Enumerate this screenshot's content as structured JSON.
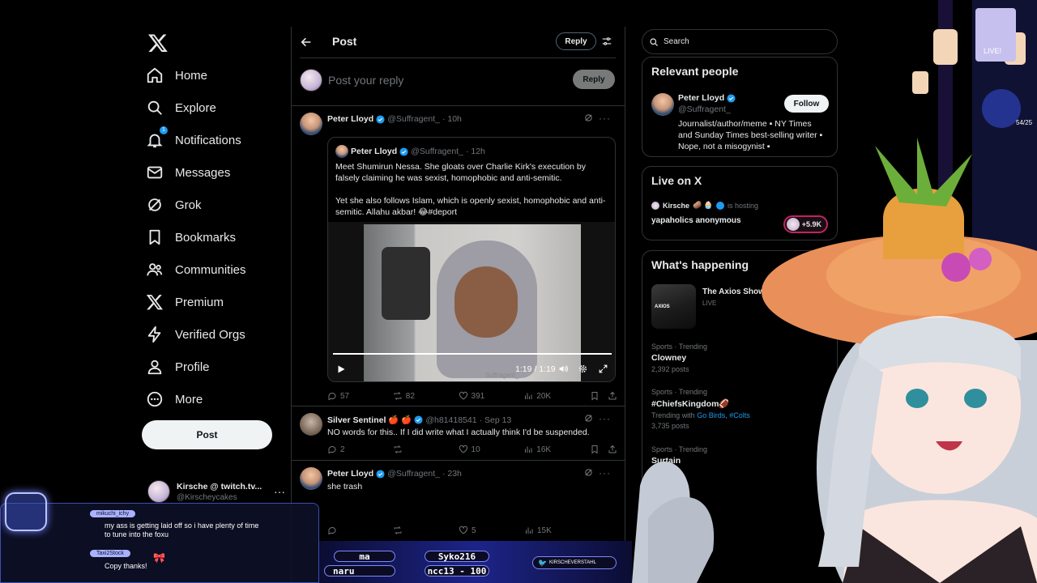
{
  "nav": {
    "items": [
      {
        "label": "Home",
        "icon": "home-icon"
      },
      {
        "label": "Explore",
        "icon": "search-icon"
      },
      {
        "label": "Notifications",
        "icon": "bell-icon",
        "badge": "1"
      },
      {
        "label": "Messages",
        "icon": "mail-icon"
      },
      {
        "label": "Grok",
        "icon": "grok-icon"
      },
      {
        "label": "Bookmarks",
        "icon": "bookmark-icon"
      },
      {
        "label": "Communities",
        "icon": "people-icon"
      },
      {
        "label": "Premium",
        "icon": "x-icon"
      },
      {
        "label": "Verified Orgs",
        "icon": "bolt-icon"
      },
      {
        "label": "Profile",
        "icon": "person-icon"
      },
      {
        "label": "More",
        "icon": "more-circle-icon"
      }
    ],
    "post_label": "Post",
    "account": {
      "name": "Kirsche @ twitch.tv...",
      "handle": "@Kirscheycakes"
    }
  },
  "header": {
    "title": "Post",
    "reply_label": "Reply"
  },
  "compose": {
    "placeholder": "Post your reply",
    "button": "Reply"
  },
  "main_tweet": {
    "name": "Peter Lloyd",
    "handle": "@Suffragent_",
    "time": "· 10h",
    "quote": {
      "name": "Peter Lloyd",
      "handle": "@Suffragent_",
      "time": "· 12h",
      "text1": "Meet Shumirun Nessa.  She gloats over Charlie Kirk's execution by falsely claiming he was sexist, homophobic and anti-semitic.",
      "text2": "Yet she also follows Islam, which is openly sexist, homophobic and anti-semitic. Allahu akbar! 😂#deport",
      "video_time": "1:19 / 1:19",
      "watermark": "Suffragent_"
    },
    "stats": {
      "replies": "57",
      "reposts": "82",
      "likes": "391",
      "views": "20K"
    }
  },
  "replies": [
    {
      "name": "Silver Sentinel 🍎 🍎",
      "handle": "@h81418541",
      "time": "· Sep 13",
      "text": "NO words for this..  If I did write what I actually think I'd be suspended.",
      "stats": {
        "replies": "2",
        "reposts": "",
        "likes": "10",
        "views": "16K"
      }
    },
    {
      "name": "Peter Lloyd",
      "handle": "@Suffragent_",
      "time": "· 23h",
      "text": "she trash",
      "stats": {
        "replies": "",
        "reposts": "",
        "likes": "5",
        "views": "15K"
      }
    }
  ],
  "right": {
    "search_placeholder": "Search",
    "relevant": {
      "title": "Relevant people",
      "name": "Peter Lloyd",
      "handle": "@Suffragent_",
      "follow": "Follow",
      "bio": "Journalist/author/meme ▪ NY Times and Sunday Times best-selling writer ▪ Nope, not a misogynist ▪"
    },
    "live": {
      "title": "Live on X",
      "host": "Kirsche",
      "emojis": "🥔 🧁",
      "hosting": "is hosting",
      "space": "yapaholics anonymous",
      "listeners": "+5.9K"
    },
    "happening": {
      "title": "What's happening",
      "show": "The Axios Show",
      "show_status": "LIVE",
      "thumb_tag": "AXIOS",
      "trends": [
        {
          "category": "Sports · Trending",
          "title": "Clowney",
          "count": "2,392 posts"
        },
        {
          "category": "Sports · Trending",
          "title": "#ChiefsKingdom🏈",
          "trending_with": "Trending with",
          "links": "Go Birds, #Colts",
          "count": "3,735 posts"
        },
        {
          "category": "Sports · Trending",
          "title": "Surtain",
          "count": ""
        }
      ]
    }
  },
  "overlay": {
    "chat": [
      {
        "user": "mikuchi_ichy",
        "text": "my ass is getting laid off so i have plenty of time to tune into the foxu"
      },
      {
        "user": "Taxi2Stock",
        "text": "Copy thanks!"
      }
    ],
    "ticker": [
      "ma",
      "Syko216",
      "naru",
      "ncc13 - 100"
    ],
    "social": "KIRSCHEVERSTAHL",
    "live_sign": "LIVE!",
    "counter": "54/25"
  },
  "colors": {
    "background": "#000000",
    "accent": "#1d9bf0",
    "border": "#2f3336",
    "muted": "#71767b"
  }
}
